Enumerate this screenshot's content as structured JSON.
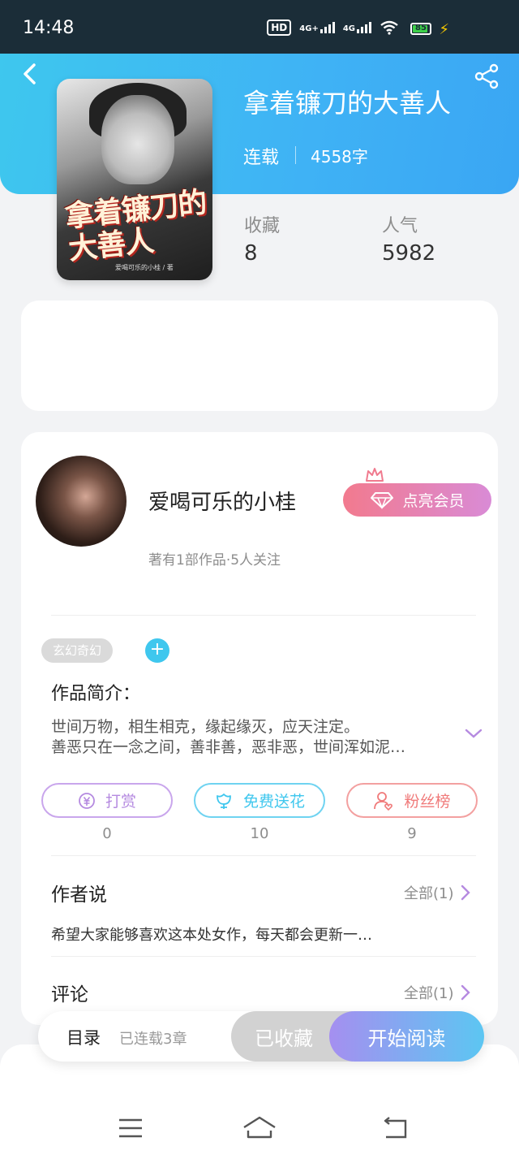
{
  "status_bar": {
    "time": "14:48",
    "hd_label": "HD",
    "signal1_label": "4G+",
    "signal2_label": "4G",
    "battery": "85"
  },
  "book": {
    "title": "拿着镰刀的大善人",
    "status": "连载",
    "word_count": "4558字",
    "cover_title": "拿着镰刀的大善人",
    "cover_subtitle": "爱喝可乐的小桂 / 著"
  },
  "stats": {
    "favorites_label": "收藏",
    "favorites_value": "8",
    "popularity_label": "人气",
    "popularity_value": "5982"
  },
  "author": {
    "name": "爱喝可乐的小桂",
    "meta": "著有1部作品·5人关注",
    "vip_label": "点亮会员"
  },
  "tags": [
    "玄幻奇幻"
  ],
  "tag_add_symbol": "+",
  "intro": {
    "title": "作品简介：",
    "line1": "世间万物，相生相克，缘起缘灭，应天注定。",
    "line2": "善恶只在一念之间，善非善，恶非恶，世间浑如泥…"
  },
  "actions": [
    {
      "label": "打赏",
      "count": "0",
      "icon": "coin-icon",
      "color": "#b58ae0"
    },
    {
      "label": "免费送花",
      "count": "10",
      "icon": "flower-icon",
      "color": "#3fc7ee"
    },
    {
      "label": "粉丝榜",
      "count": "9",
      "icon": "fan-icon",
      "color": "#f07a7a"
    }
  ],
  "author_says": {
    "title": "作者说",
    "more": "全部(1)",
    "text": "希望大家能够喜欢这本处女作，每天都会更新一…"
  },
  "comments": {
    "title": "评论",
    "more": "全部(1)"
  },
  "bottom_bar": {
    "toc_label": "目录",
    "chapters": "已连载3章",
    "collected_label": "已收藏",
    "read_label": "开始阅读"
  },
  "colors": {
    "header_gradient_start": "#3ec7ee",
    "header_gradient_end": "#3aa6f3",
    "vip_gradient_start": "#f27a8e",
    "vip_gradient_end": "#d98bd6",
    "read_gradient_start": "#a58ff0",
    "read_gradient_end": "#5cc6f2"
  }
}
